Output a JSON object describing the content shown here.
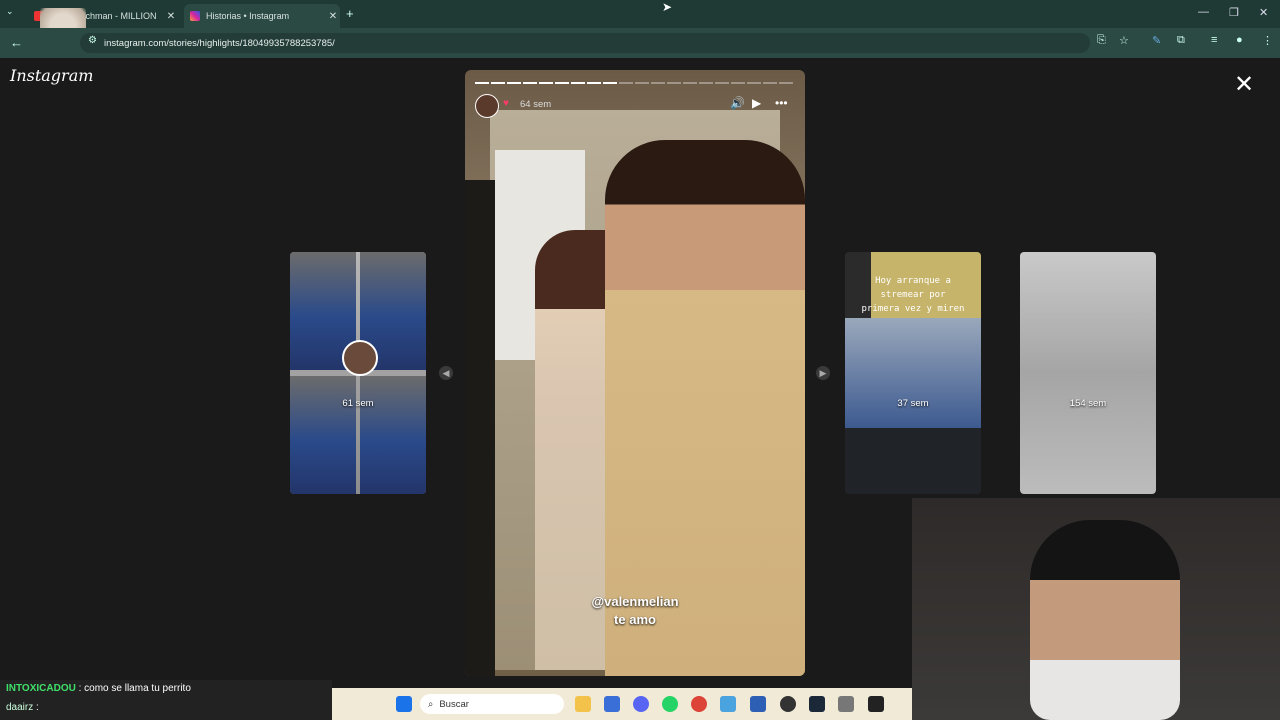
{
  "browser": {
    "tabs": [
      {
        "title": "ommy Richman - MILLION",
        "active": false
      },
      {
        "title": "Historias • Instagram",
        "active": true
      }
    ],
    "url": "instagram.com/stories/highlights/18049935788253785/",
    "accent": "#1f3a34"
  },
  "instagram": {
    "logo": "Instagram",
    "main_story": {
      "time": "64 sem",
      "caption_mention": "@valenmelian",
      "caption_text": "te amo",
      "progress_segments": 20,
      "progress_done": 9
    },
    "side_stories": [
      {
        "time": "61 sem"
      },
      {
        "time": "37 sem",
        "note": "Hoy arranque a stremear por primera vez y miren"
      },
      {
        "time": "154 sem"
      }
    ]
  },
  "chat": [
    {
      "user": "INTOXICADOU",
      "message": ": como se llama tu perrito"
    },
    {
      "user": "daairz",
      "message": ":"
    }
  ],
  "taskbar": {
    "search_placeholder": "Buscar"
  }
}
